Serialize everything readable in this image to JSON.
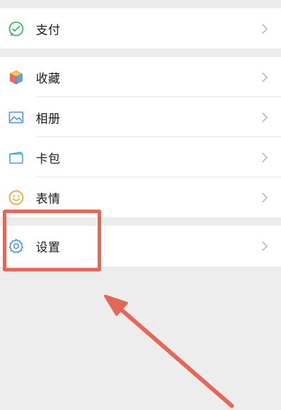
{
  "menu": {
    "pay": {
      "label": "支付",
      "icon": "wechat-pay-icon"
    },
    "favorites": {
      "label": "收藏",
      "icon": "favorites-cube-icon"
    },
    "album": {
      "label": "相册",
      "icon": "photo-album-icon"
    },
    "cards": {
      "label": "卡包",
      "icon": "card-wallet-icon"
    },
    "stickers": {
      "label": "表情",
      "icon": "smiley-icon"
    },
    "settings": {
      "label": "设置",
      "icon": "gear-icon"
    }
  },
  "annotation": {
    "highlight_color": "#e4685a",
    "arrow_color": "#e4685a"
  },
  "colors": {
    "pay_green": "#3ab56b",
    "album_blue": "#4a8fd6",
    "smiley_orange": "#f0a53a",
    "settings_blue": "#4a8fd6"
  }
}
